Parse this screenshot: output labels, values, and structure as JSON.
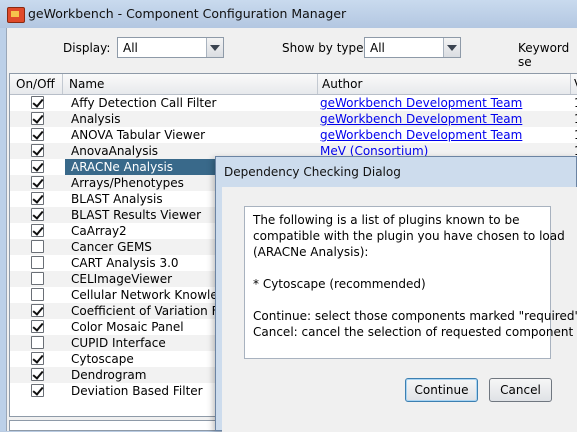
{
  "window": {
    "title": "geWorkbench - Component Configuration Manager"
  },
  "filters": {
    "display_label": "Display:",
    "display_value": "All",
    "type_label": "Show by type:",
    "type_value": "All",
    "keyword_label": "Keyword se"
  },
  "table": {
    "columns": [
      "On/Off",
      "Name",
      "Author",
      "V"
    ],
    "rows": [
      {
        "on": true,
        "name": "Affy Detection Call Filter",
        "author": "geWorkbench Development Team",
        "v": "1"
      },
      {
        "on": true,
        "name": "Analysis",
        "author": "geWorkbench Development Team",
        "v": "1"
      },
      {
        "on": true,
        "name": "ANOVA Tabular Viewer",
        "author": "geWorkbench Development Team",
        "v": "1"
      },
      {
        "on": true,
        "name": "AnovaAnalysis",
        "author": "MeV (Consortium)",
        "v": "1"
      },
      {
        "on": true,
        "name": "ARACNe Analysis",
        "author": "",
        "v": "",
        "selected": true
      },
      {
        "on": true,
        "name": "Arrays/Phenotypes",
        "author": "",
        "v": ""
      },
      {
        "on": true,
        "name": "BLAST Analysis",
        "author": "",
        "v": ""
      },
      {
        "on": true,
        "name": "BLAST Results Viewer",
        "author": "",
        "v": ""
      },
      {
        "on": true,
        "name": "CaArray2",
        "author": "",
        "v": ""
      },
      {
        "on": false,
        "name": "Cancer GEMS",
        "author": "",
        "v": ""
      },
      {
        "on": false,
        "name": "CART Analysis 3.0",
        "author": "",
        "v": ""
      },
      {
        "on": false,
        "name": "CELImageViewer",
        "author": "",
        "v": ""
      },
      {
        "on": false,
        "name": "Cellular Network Knowledge",
        "author": "",
        "v": ""
      },
      {
        "on": true,
        "name": "Coefficient of Variation Filter",
        "author": "",
        "v": ""
      },
      {
        "on": true,
        "name": "Color Mosaic Panel",
        "author": "",
        "v": ""
      },
      {
        "on": false,
        "name": "CUPID Interface",
        "author": "",
        "v": ""
      },
      {
        "on": true,
        "name": "Cytoscape",
        "author": "",
        "v": ""
      },
      {
        "on": true,
        "name": "Dendrogram",
        "author": "",
        "v": ""
      },
      {
        "on": true,
        "name": "Deviation Based Filter",
        "author": "",
        "v": ""
      }
    ]
  },
  "dialog": {
    "title": "Dependency Checking Dialog",
    "lines": [
      "The following is a list of plugins known to be",
      "compatible with the plugin you have chosen to load",
      "(ARACNe Analysis):",
      "* Cytoscape (recommended)",
      "Continue: select those components marked \"required\"",
      "Cancel: cancel the selection of requested component"
    ],
    "continue_label": "Continue",
    "cancel_label": "Cancel"
  }
}
